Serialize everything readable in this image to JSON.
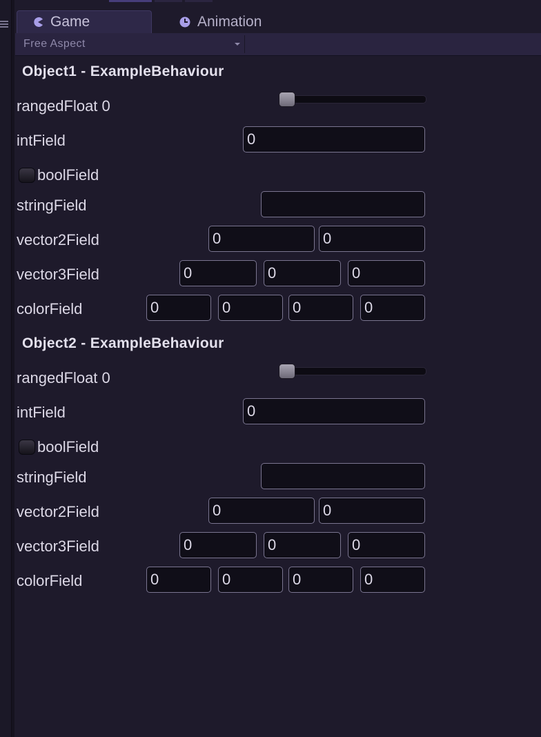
{
  "tabs": [
    {
      "label": "Game",
      "icon": "pacman-icon",
      "active": true
    },
    {
      "label": "Animation",
      "icon": "clock-icon",
      "active": false
    }
  ],
  "aspect": {
    "selected": "Free Aspect"
  },
  "objects": [
    {
      "title": "Object1 - ExampleBehaviour",
      "rangedFloat": {
        "label": "rangedFloat 0",
        "value": 0
      },
      "intField": {
        "label": "intField",
        "value": "0"
      },
      "boolField": {
        "label": "boolField",
        "value": false
      },
      "stringField": {
        "label": "stringField",
        "value": ""
      },
      "vector2Field": {
        "label": "vector2Field",
        "values": [
          "0",
          "0"
        ]
      },
      "vector3Field": {
        "label": "vector3Field",
        "values": [
          "0",
          "0",
          "0"
        ]
      },
      "colorField": {
        "label": "colorField",
        "values": [
          "0",
          "0",
          "0",
          "0"
        ]
      }
    },
    {
      "title": "Object2 - ExampleBehaviour",
      "rangedFloat": {
        "label": "rangedFloat 0",
        "value": 0
      },
      "intField": {
        "label": "intField",
        "value": "0"
      },
      "boolField": {
        "label": "boolField",
        "value": false
      },
      "stringField": {
        "label": "stringField",
        "value": ""
      },
      "vector2Field": {
        "label": "vector2Field",
        "values": [
          "0",
          "0"
        ]
      },
      "vector3Field": {
        "label": "vector3Field",
        "values": [
          "0",
          "0",
          "0"
        ]
      },
      "colorField": {
        "label": "colorField",
        "values": [
          "0",
          "0",
          "0",
          "0"
        ]
      }
    }
  ],
  "colors": {
    "accent": "#8a7fd6",
    "background": "#1e1a2b",
    "input_bg": "#100e18",
    "input_border": "#7a7590"
  }
}
